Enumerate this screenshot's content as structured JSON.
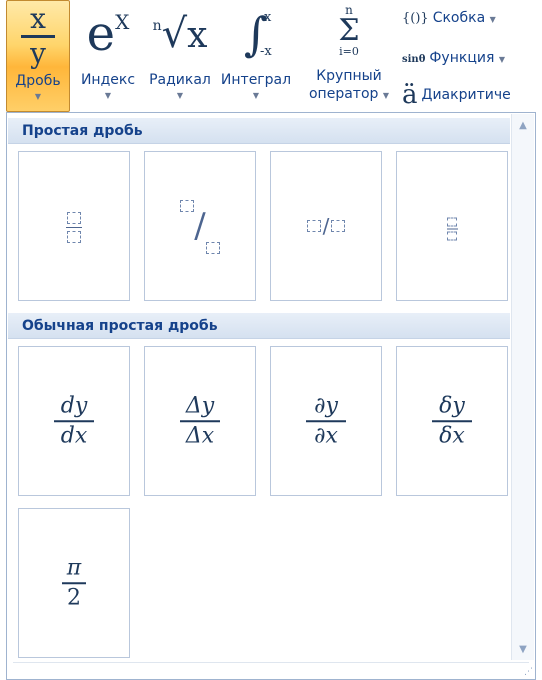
{
  "ribbon": {
    "buttons": [
      {
        "label": "Дробь",
        "icon_top": "x",
        "icon_bottom": "y",
        "active": true
      },
      {
        "label": "Индекс",
        "icon": "eˣ"
      },
      {
        "label": "Радикал",
        "icon": "ⁿ√x"
      },
      {
        "label": "Интеграл",
        "icon": "∫"
      },
      {
        "label_line1": "Крупный",
        "label_line2": "оператор",
        "icon": "Σ"
      }
    ],
    "index_icon_base": "e",
    "index_icon_sup": "X",
    "radical_index": "n",
    "radical_sign": "√",
    "radical_x": "x",
    "integral_sign": "∫",
    "integral_upper": "x",
    "integral_lower": "-x",
    "sum_top": "n",
    "sum_sign": "Σ",
    "sum_bottom": "i=0",
    "small_items": [
      {
        "icon": "{()}",
        "label": "Скобка"
      },
      {
        "icon": "sinθ",
        "label": "Функция"
      },
      {
        "icon": "ä",
        "label": "Диакритиче"
      }
    ],
    "dropdown_arrow": "▼",
    "active_color": "#ffd56b"
  },
  "panel": {
    "section1_title": "Простая дробь",
    "section2_title": "Обычная простая дробь",
    "common": [
      {
        "top": "dy",
        "bottom": "dx"
      },
      {
        "top": "Δy",
        "bottom": "Δx"
      },
      {
        "top": "∂y",
        "bottom": "∂x"
      },
      {
        "top": "δy",
        "bottom": "δx"
      },
      {
        "top": "π",
        "bottom": "2"
      }
    ],
    "slash": "/",
    "scroll_up": "▲",
    "scroll_down": "▼",
    "resize_grip": "⋰"
  }
}
